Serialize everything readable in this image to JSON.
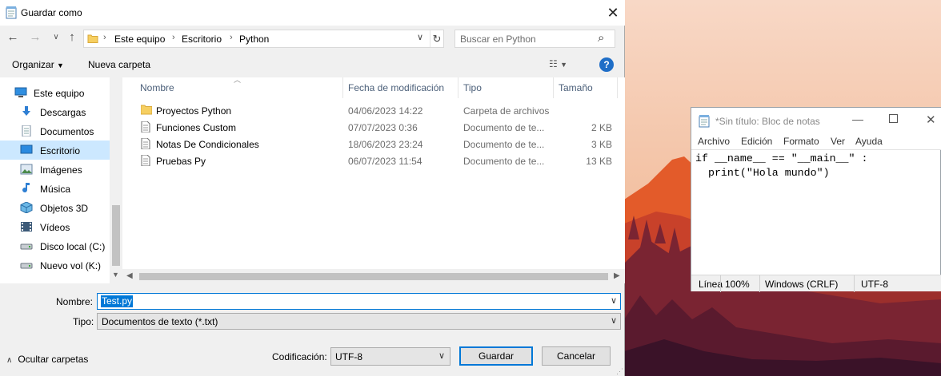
{
  "dialog": {
    "title": "Guardar como",
    "address": {
      "crumbs": [
        "Este equipo",
        "Escritorio",
        "Python"
      ]
    },
    "search": {
      "placeholder": "Buscar en Python"
    },
    "toolbar": {
      "organize": "Organizar",
      "new_folder": "Nueva carpeta",
      "help": "?"
    },
    "nav_items": [
      {
        "label": "Este equipo",
        "icon": "computer-icon",
        "root": true,
        "selected": false
      },
      {
        "label": "Descargas",
        "icon": "download-icon",
        "selected": false
      },
      {
        "label": "Documentos",
        "icon": "documents-icon",
        "selected": false
      },
      {
        "label": "Escritorio",
        "icon": "desktop-icon",
        "selected": true
      },
      {
        "label": "Imágenes",
        "icon": "pictures-icon",
        "selected": false
      },
      {
        "label": "Música",
        "icon": "music-icon",
        "selected": false
      },
      {
        "label": "Objetos 3D",
        "icon": "cube-icon",
        "selected": false
      },
      {
        "label": "Vídeos",
        "icon": "video-icon",
        "selected": false
      },
      {
        "label": "Disco local (C:)",
        "icon": "drive-icon",
        "selected": false
      },
      {
        "label": "Nuevo vol (K:)",
        "icon": "drive-icon",
        "selected": false
      }
    ],
    "columns": {
      "name": "Nombre",
      "modified": "Fecha de modificación",
      "type": "Tipo",
      "size": "Tamaño"
    },
    "files": [
      {
        "name": "Proyectos Python",
        "modified": "04/06/2023 14:22",
        "type": "Carpeta de archivos",
        "size": "",
        "icon": "folder-icon"
      },
      {
        "name": "Funciones Custom",
        "modified": "07/07/2023 0:36",
        "type": "Documento de te...",
        "size": "2 KB",
        "icon": "text-file-icon"
      },
      {
        "name": "Notas De Condicionales",
        "modified": "18/06/2023 23:24",
        "type": "Documento de te...",
        "size": "3 KB",
        "icon": "text-file-icon"
      },
      {
        "name": "Pruebas Py",
        "modified": "06/07/2023 11:54",
        "type": "Documento de te...",
        "size": "13 KB",
        "icon": "text-file-icon"
      }
    ],
    "filename_label": "Nombre:",
    "filename_value": "Test.py",
    "filetype_label": "Tipo:",
    "filetype_value": "Documentos de texto (*.txt)",
    "hide_folders": "Ocultar carpetas",
    "encoding_label": "Codificación:",
    "encoding_value": "UTF-8",
    "save": "Guardar",
    "cancel": "Cancelar"
  },
  "notepad": {
    "title": "*Sin título: Bloc de notas",
    "menu": [
      "Archivo",
      "Edición",
      "Formato",
      "Ver",
      "Ayuda"
    ],
    "content": "if __name__ == \"__main__\" :\n  print(\"Hola mundo\")",
    "status": {
      "position": "Línea",
      "zoom": "100%",
      "line_ending": "Windows (CRLF)",
      "encoding": "UTF-8"
    }
  },
  "colors": {
    "accent": "#0078d7",
    "selection": "#cce8ff",
    "header_text": "#4c607a"
  }
}
